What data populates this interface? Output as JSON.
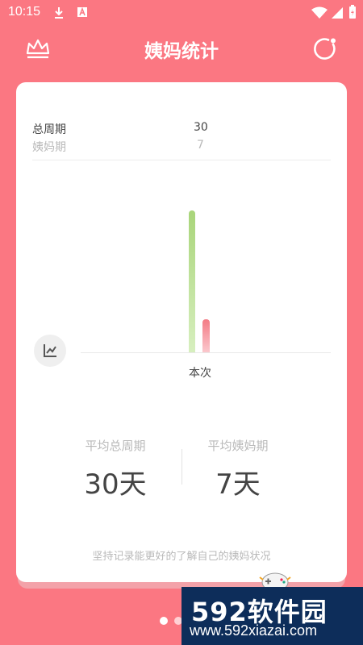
{
  "status_bar": {
    "time": "10:15"
  },
  "header": {
    "title": "姨妈统计"
  },
  "legend": {
    "rows": [
      {
        "label": "总周期",
        "value": "30"
      },
      {
        "label": "姨妈期",
        "value": "7"
      }
    ]
  },
  "chart_data": {
    "type": "bar",
    "categories": [
      "本次"
    ],
    "series": [
      {
        "name": "总周期",
        "values": [
          30
        ]
      },
      {
        "name": "姨妈期",
        "values": [
          7
        ]
      }
    ],
    "ylim": [
      0,
      30
    ],
    "grid": false,
    "colors": [
      "#a9d57a",
      "#f37b85"
    ]
  },
  "stats": {
    "avg_total_label": "平均总周期",
    "avg_total_value": "30天",
    "avg_period_label": "平均姨妈期",
    "avg_period_value": "7天"
  },
  "tip": "坚持记录能更好的了解自己的姨妈状况",
  "pagination": {
    "total": 2,
    "active": 0
  },
  "watermark": {
    "brand": "592软件园",
    "url": "www.592xiazai.com"
  },
  "colors": {
    "background": "#fb7782",
    "card": "#ffffff",
    "bar_total": "#a9d57a",
    "bar_period": "#f37b85"
  }
}
